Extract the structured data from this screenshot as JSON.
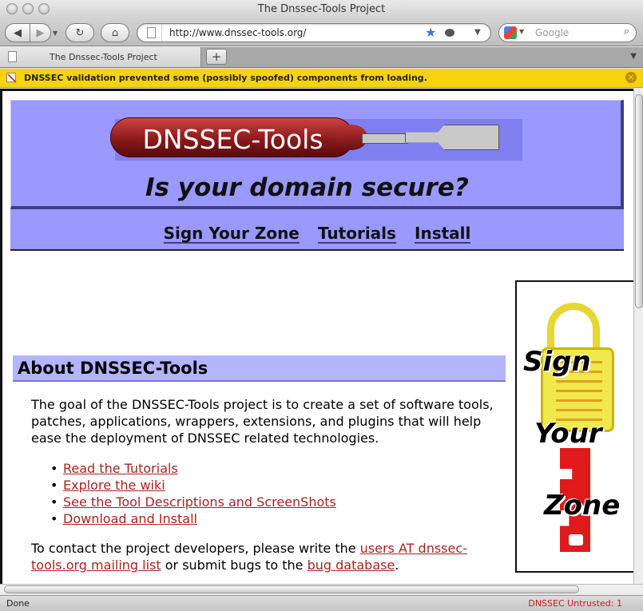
{
  "window": {
    "title": "The Dnssec-Tools Project"
  },
  "toolbar": {
    "back_glyph": "◀",
    "forward_glyph": "▶",
    "reload_glyph": "↻",
    "home_glyph": "⌂",
    "url": "http://www.dnssec-tools.org/",
    "search_placeholder": "Google"
  },
  "tabs": [
    {
      "label": "The Dnssec-Tools Project"
    }
  ],
  "notification": {
    "text": "DNSSEC validation prevented some (possibly spoofed) components from loading."
  },
  "page": {
    "logo_text": "DNSSEC-Tools",
    "tagline": "Is your domain secure?",
    "nav": [
      "Sign Your Zone",
      "Tutorials",
      "Install"
    ],
    "sidebar_words": [
      "Sign",
      "Your",
      "Zone"
    ],
    "about_heading": "About DNSSEC-Tools",
    "about_text": "The goal of the DNSSEC-Tools project is to create a set of software tools, patches, applications, wrappers, extensions, and plugins that will help ease the deployment of DNSSEC related technologies.",
    "links": [
      "Read the Tutorials",
      "Explore the wiki",
      "See the Tool Descriptions and ScreenShots",
      "Download and Install"
    ],
    "contact": {
      "prefix": "To contact the project developers, please write the ",
      "link1": "users AT dnssec-tools.org mailing list",
      "middle": " or submit bugs to the ",
      "link2": "bug database",
      "suffix": "."
    }
  },
  "statusbar": {
    "left": "Done",
    "right": "DNSSEC Untrusted:    1"
  },
  "colors": {
    "banner": "#9999ff",
    "notification": "#f5d30e",
    "link": "#a22222"
  }
}
